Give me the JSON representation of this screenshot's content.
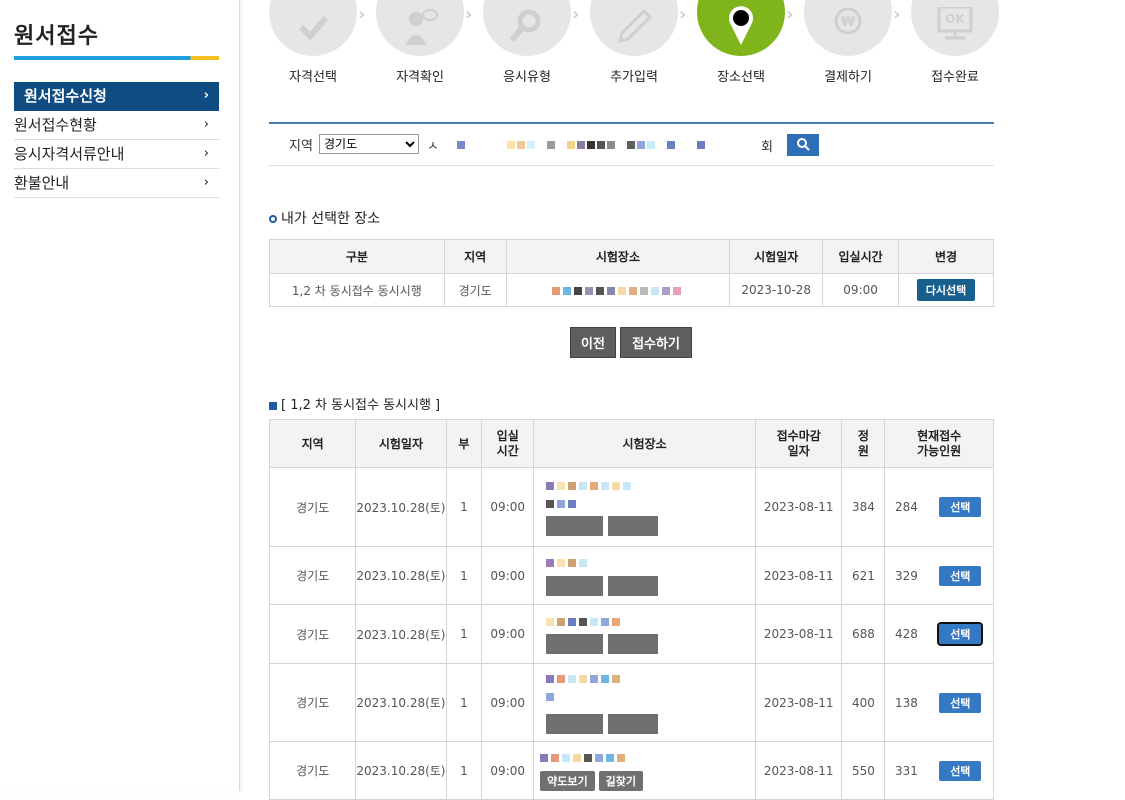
{
  "sidebar": {
    "title": "원서접수",
    "menu": [
      {
        "label": "원서접수신청",
        "active": true
      },
      {
        "label": "원서접수현황",
        "active": false
      },
      {
        "label": "응시자격서류안내",
        "active": false
      },
      {
        "label": "환불안내",
        "active": false
      }
    ]
  },
  "steps": [
    {
      "label": "자격선택",
      "icon": "check-icon"
    },
    {
      "label": "자격확인",
      "icon": "person-icon"
    },
    {
      "label": "응시유형",
      "icon": "magnifier-icon"
    },
    {
      "label": "추가입력",
      "icon": "pencil-icon"
    },
    {
      "label": "장소선택",
      "icon": "location-pin-icon",
      "active": true
    },
    {
      "label": "결제하기",
      "icon": "won-coin-icon"
    },
    {
      "label": "접수완료",
      "icon": "monitor-ok-icon"
    }
  ],
  "steps_ok_text": "OK",
  "search": {
    "region_label": "지역",
    "region_value": "경기도",
    "fragment_left": "ㅅ",
    "fragment_right": "회"
  },
  "my_selection": {
    "title": "내가 선택한 장소",
    "headers": [
      "구분",
      "지역",
      "시험장소",
      "시험일자",
      "입실시간",
      "변경"
    ],
    "row": {
      "category": "1,2 차 동시접수 동시시행",
      "region": "경기도",
      "date": "2023-10-28",
      "time": "09:00",
      "reselect": "다시선택"
    }
  },
  "buttons": {
    "prev": "이전",
    "submit": "접수하기"
  },
  "list": {
    "title": "[ 1,2 차 동시접수 동시시행 ]",
    "headers": {
      "region": "지역",
      "date": "시험일자",
      "part": "부",
      "entry_1": "입실",
      "entry_2": "시간",
      "venue": "시험장소",
      "deadline_1": "접수마감",
      "deadline_2": "일자",
      "capacity_1": "정",
      "capacity_2": "원",
      "avail_1": "현재접수",
      "avail_2": "가능인원"
    },
    "rows": [
      {
        "region": "경기도",
        "date": "2023.10.28(토)",
        "part": "1",
        "time": "09:00",
        "deadline": "2023-08-11",
        "capacity": "384",
        "available": "284",
        "select": "선택"
      },
      {
        "region": "경기도",
        "date": "2023.10.28(토)",
        "part": "1",
        "time": "09:00",
        "deadline": "2023-08-11",
        "capacity": "621",
        "available": "329",
        "select": "선택"
      },
      {
        "region": "경기도",
        "date": "2023.10.28(토)",
        "part": "1",
        "time": "09:00",
        "deadline": "2023-08-11",
        "capacity": "688",
        "available": "428",
        "select": "선택"
      },
      {
        "region": "경기도",
        "date": "2023.10.28(토)",
        "part": "1",
        "time": "09:00",
        "deadline": "2023-08-11",
        "capacity": "400",
        "available": "138",
        "select": "선택"
      },
      {
        "region": "경기도",
        "date": "2023.10.28(토)",
        "part": "1",
        "time": "09:00",
        "deadline": "2023-08-11",
        "capacity": "550",
        "available": "331",
        "select": "선택"
      }
    ],
    "map_btn": "약도보기",
    "route_btn": "길찾기"
  },
  "colors": {
    "navy": "#0f4c81",
    "active_step": "#7fb51b",
    "select_button": "#3579c4",
    "reselect_button": "#175f8d"
  }
}
